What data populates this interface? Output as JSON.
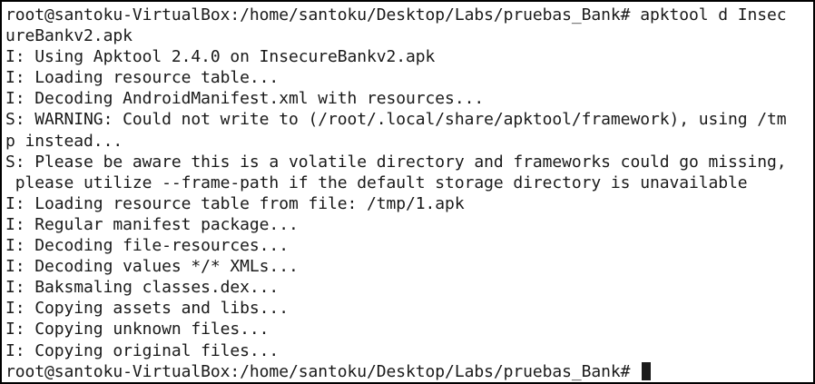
{
  "terminal": {
    "lines": [
      "root@santoku-VirtualBox:/home/santoku/Desktop/Labs/pruebas_Bank# apktool d Insec",
      "ureBankv2.apk",
      "I: Using Apktool 2.4.0 on InsecureBankv2.apk",
      "I: Loading resource table...",
      "I: Decoding AndroidManifest.xml with resources...",
      "S: WARNING: Could not write to (/root/.local/share/apktool/framework), using /tm",
      "p instead...",
      "S: Please be aware this is a volatile directory and frameworks could go missing,",
      " please utilize --frame-path if the default storage directory is unavailable",
      "I: Loading resource table from file: /tmp/1.apk",
      "I: Regular manifest package...",
      "I: Decoding file-resources...",
      "I: Decoding values */* XMLs...",
      "I: Baksmaling classes.dex...",
      "I: Copying assets and libs...",
      "I: Copying unknown files...",
      "I: Copying original files..."
    ],
    "prompt": "root@santoku-VirtualBox:/home/santoku/Desktop/Labs/pruebas_Bank# "
  }
}
